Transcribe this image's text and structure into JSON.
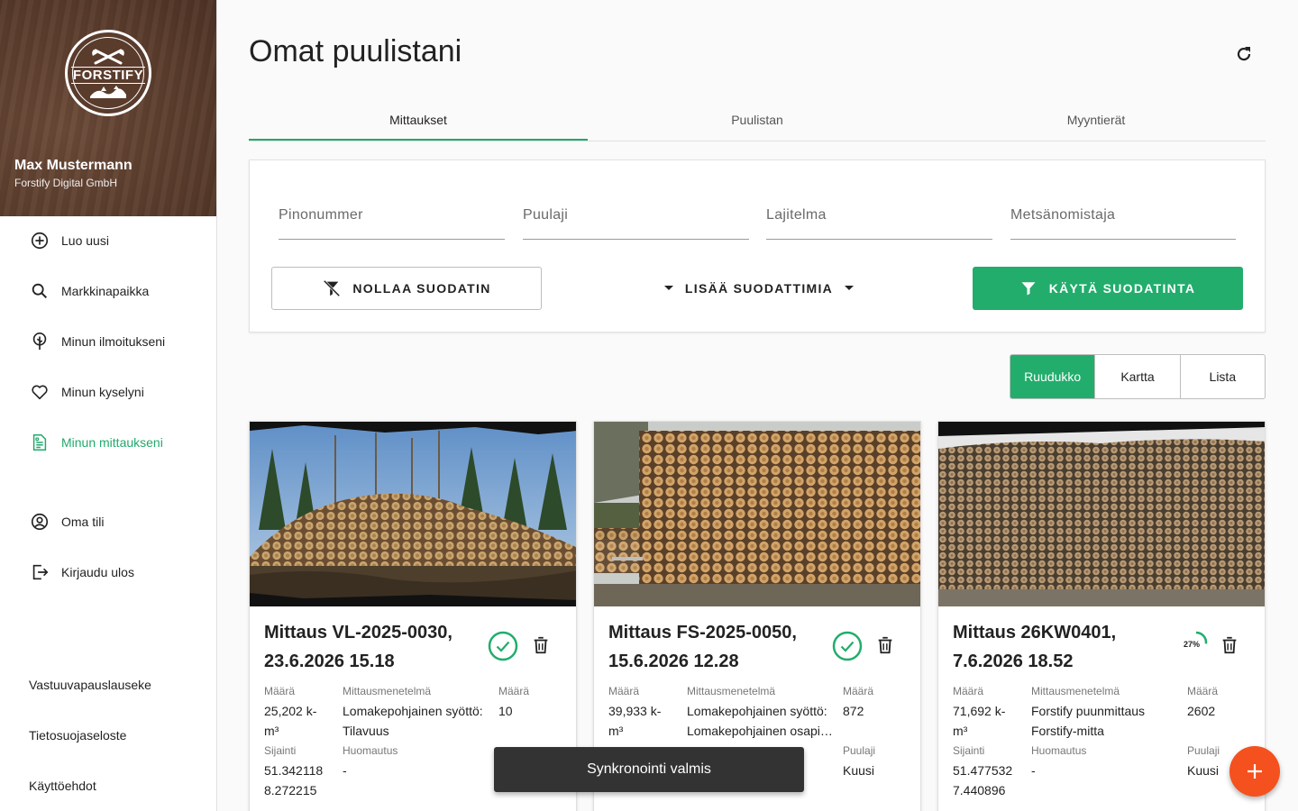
{
  "brand": {
    "logo_text": "FORSTIFY"
  },
  "user": {
    "name": "Max Mustermann",
    "company": "Forstify Digital GmbH"
  },
  "nav": {
    "items": [
      {
        "label": "Luo uusi",
        "icon": "plus-circle-icon"
      },
      {
        "label": "Markkinapaikka",
        "icon": "search-icon"
      },
      {
        "label": "Minun ilmoitukseni",
        "icon": "tree-icon"
      },
      {
        "label": "Minun kyselyni",
        "icon": "heart-icon"
      },
      {
        "label": "Minun mittaukseni",
        "icon": "measurement-doc-icon",
        "active": true
      },
      {
        "label": "Oma tili",
        "icon": "account-icon"
      },
      {
        "label": "Kirjaudu ulos",
        "icon": "logout-icon"
      }
    ],
    "footer": [
      "Vastuuvapauslauseke",
      "Tietosuojaseloste",
      "Käyttöehdot"
    ]
  },
  "page": {
    "title": "Omat puulistani"
  },
  "tabs": [
    {
      "label": "Mittaukset",
      "active": true
    },
    {
      "label": "Puulistan",
      "active": false
    },
    {
      "label": "Myyntierät",
      "active": false
    }
  ],
  "filters": {
    "fields": [
      {
        "placeholder": "Pinonummer",
        "value": ""
      },
      {
        "placeholder": "Puulaji",
        "value": ""
      },
      {
        "placeholder": "Lajitelma",
        "value": ""
      },
      {
        "placeholder": "Metsänomistaja",
        "value": ""
      }
    ],
    "reset_label": "NOLLAA SUODATIN",
    "more_label": "LISÄÄ SUODATTIMIA",
    "apply_label": "KÄYTÄ SUODATINTA"
  },
  "view_toggle": {
    "options": [
      "Ruudukko",
      "Kartta",
      "Lista"
    ],
    "selected": "Ruudukko"
  },
  "cards": [
    {
      "title": "Mittaus VL-2025-0030, 23.6.2026 15.18",
      "status": "complete",
      "labels": {
        "amount": "Määrä",
        "method": "Mittausmenetelmä",
        "count": "Määrä",
        "location": "Sijainti",
        "note": "Huomautus"
      },
      "amount": "25,202 k-m³",
      "method": "Lomakepohjainen syöttö: Tilavuus",
      "count": "10",
      "location": "51.342118 8.272215",
      "note": "-"
    },
    {
      "title": "Mittaus FS-2025-0050, 15.6.2026 12.28",
      "status": "complete",
      "labels": {
        "amount": "Määrä",
        "method": "Mittausmenetelmä",
        "count": "Määrä",
        "species": "Puulaji"
      },
      "amount": "39,933 k-m³",
      "method": "Lomakepohjainen syöttö: Lomakepohjainen osapi…",
      "count": "872",
      "species": "Kuusi"
    },
    {
      "title": "Mittaus 26KW0401, 7.6.2026 18.52",
      "status": "progress",
      "progress_label": "27%",
      "progress": 0.27,
      "labels": {
        "amount": "Määrä",
        "method": "Mittausmenetelmä",
        "count": "Määrä",
        "location": "Sijainti",
        "note": "Huomautus",
        "species": "Puulaji"
      },
      "amount": "71,692 k-m³",
      "method": "Forstify puunmittaus Forstify-mitta",
      "count": "2602",
      "location": "51.477532 7.440896",
      "note": "-",
      "species": "Kuusi"
    }
  ],
  "snackbar": {
    "message": "Synkronointi valmis"
  },
  "colors": {
    "primary": "#22ad6c",
    "fab": "#f4511e",
    "sidebar_header": "#5a3c2c"
  }
}
